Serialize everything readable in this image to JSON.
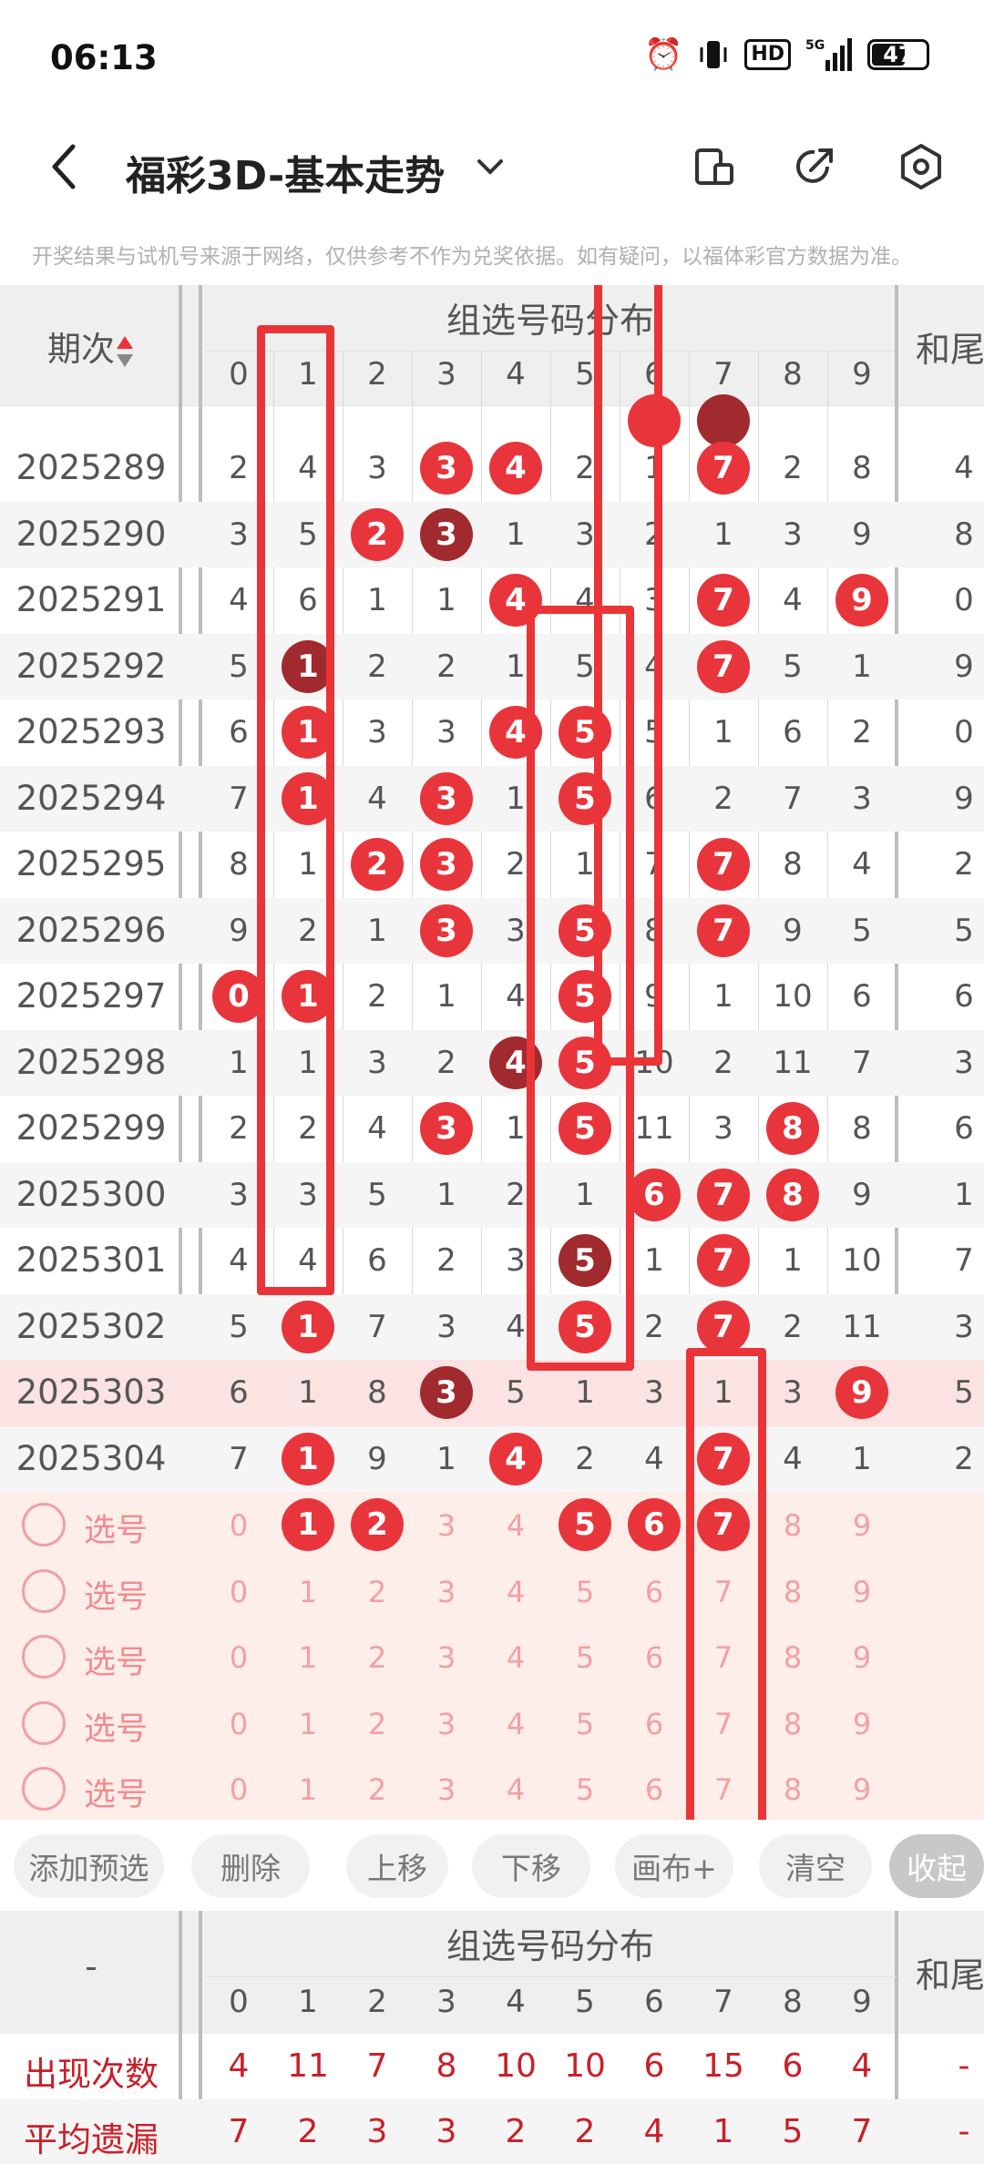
{
  "status": {
    "time": "06:13",
    "hd": "HD",
    "network": "5G",
    "battery": "47"
  },
  "header": {
    "title": "福彩3D-基本走势"
  },
  "disclaimer": "开奖结果与试机号来源于网络，仅供参考不作为兑奖依据。如有疑问，以福体彩官方数据为准。",
  "table": {
    "period_header": "期次",
    "group_header": "组选号码分布",
    "sum_header": "和尾",
    "digits": [
      "0",
      "1",
      "2",
      "3",
      "4",
      "5",
      "6",
      "7",
      "8",
      "9"
    ],
    "rows": [
      {
        "period": "2025289",
        "cells": [
          "2",
          "4",
          "3",
          "3",
          "4",
          "2",
          "1",
          "7",
          "2",
          "8"
        ],
        "sum": "4"
      },
      {
        "period": "2025290",
        "cells": [
          "3",
          "5",
          "2",
          "3",
          "1",
          "3",
          "2",
          "1",
          "3",
          "9"
        ],
        "sum": "8"
      },
      {
        "period": "2025291",
        "cells": [
          "4",
          "6",
          "1",
          "1",
          "4",
          "4",
          "3",
          "7",
          "4",
          "9"
        ],
        "sum": "0"
      },
      {
        "period": "2025292",
        "cells": [
          "5",
          "1",
          "2",
          "2",
          "1",
          "5",
          "4",
          "7",
          "5",
          "1"
        ],
        "sum": "9"
      },
      {
        "period": "2025293",
        "cells": [
          "6",
          "1",
          "3",
          "3",
          "4",
          "5",
          "5",
          "1",
          "6",
          "2"
        ],
        "sum": "0"
      },
      {
        "period": "2025294",
        "cells": [
          "7",
          "1",
          "4",
          "3",
          "1",
          "5",
          "6",
          "2",
          "7",
          "3"
        ],
        "sum": "9"
      },
      {
        "period": "2025295",
        "cells": [
          "8",
          "1",
          "2",
          "3",
          "2",
          "1",
          "7",
          "7",
          "8",
          "4"
        ],
        "sum": "2"
      },
      {
        "period": "2025296",
        "cells": [
          "9",
          "2",
          "1",
          "3",
          "3",
          "5",
          "8",
          "7",
          "9",
          "5"
        ],
        "sum": "5"
      },
      {
        "period": "2025297",
        "cells": [
          "0",
          "1",
          "2",
          "1",
          "4",
          "5",
          "9",
          "1",
          "10",
          "6"
        ],
        "sum": "6"
      },
      {
        "period": "2025298",
        "cells": [
          "1",
          "1",
          "3",
          "2",
          "4",
          "5",
          "10",
          "2",
          "11",
          "7"
        ],
        "sum": "3"
      },
      {
        "period": "2025299",
        "cells": [
          "2",
          "2",
          "4",
          "3",
          "1",
          "5",
          "11",
          "3",
          "8",
          "8"
        ],
        "sum": "6"
      },
      {
        "period": "2025300",
        "cells": [
          "3",
          "3",
          "5",
          "1",
          "2",
          "1",
          "6",
          "7",
          "8",
          "9"
        ],
        "sum": "1"
      },
      {
        "period": "2025301",
        "cells": [
          "4",
          "4",
          "6",
          "2",
          "3",
          "5",
          "1",
          "7",
          "1",
          "10"
        ],
        "sum": "7"
      },
      {
        "period": "2025302",
        "cells": [
          "5",
          "1",
          "7",
          "3",
          "4",
          "5",
          "2",
          "7",
          "2",
          "11"
        ],
        "sum": "3"
      },
      {
        "period": "2025303",
        "cells": [
          "6",
          "1",
          "8",
          "3",
          "5",
          "1",
          "3",
          "1",
          "3",
          "9"
        ],
        "sum": "5"
      },
      {
        "period": "2025304",
        "cells": [
          "7",
          "1",
          "9",
          "1",
          "4",
          "2",
          "4",
          "7",
          "4",
          "1"
        ],
        "sum": "2"
      }
    ],
    "pick_label": "选号",
    "pick_rows": [
      [
        "0",
        "1",
        "2",
        "3",
        "4",
        "5",
        "6",
        "7",
        "8",
        "9"
      ],
      [
        "0",
        "1",
        "2",
        "3",
        "4",
        "5",
        "6",
        "7",
        "8",
        "9"
      ],
      [
        "0",
        "1",
        "2",
        "3",
        "4",
        "5",
        "6",
        "7",
        "8",
        "9"
      ],
      [
        "0",
        "1",
        "2",
        "3",
        "4",
        "5",
        "6",
        "7",
        "8",
        "9"
      ],
      [
        "0",
        "1",
        "2",
        "3",
        "4",
        "5",
        "6",
        "7",
        "8",
        "9"
      ]
    ]
  },
  "toolbar": {
    "buttons": [
      "添加预选",
      "删除",
      "上移",
      "下移",
      "画布+",
      "清空"
    ],
    "collapse": "收起"
  },
  "stats": {
    "dash": "-",
    "group_header": "组选号码分布",
    "sum_header": "和尾",
    "rows": [
      {
        "label": "出现次数",
        "values": [
          "4",
          "11",
          "7",
          "8",
          "10",
          "10",
          "6",
          "15",
          "6",
          "4"
        ],
        "sum": "-"
      },
      {
        "label": "平均遗漏",
        "values": [
          "7",
          "2",
          "3",
          "3",
          "2",
          "2",
          "4",
          "1",
          "5",
          "7"
        ],
        "sum": "-"
      }
    ]
  }
}
